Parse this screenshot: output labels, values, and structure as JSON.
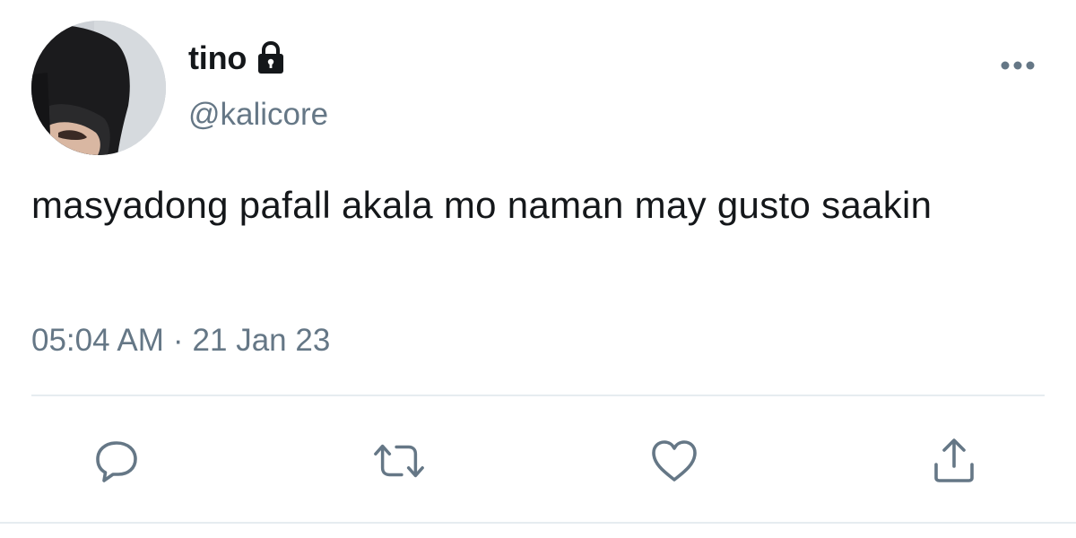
{
  "author": {
    "display_name": "tino",
    "handle": "@kalicore",
    "protected_icon": "lock-icon",
    "avatar": "profile-photo"
  },
  "tweet": {
    "text": "masyadong pafall akala mo naman may gusto saakin",
    "time": "05:04 AM",
    "separator": "·",
    "date": "21 Jan 23"
  },
  "menu": {
    "icon": "more-dots-icon"
  },
  "actions": [
    {
      "name": "reply",
      "icon": "reply-icon"
    },
    {
      "name": "retweet",
      "icon": "retweet-icon"
    },
    {
      "name": "like",
      "icon": "heart-icon"
    },
    {
      "name": "share",
      "icon": "share-icon"
    }
  ],
  "colors": {
    "primary_text": "#14171a",
    "secondary_text": "#657786",
    "divider": "#e6ecf0",
    "icon": "#657786"
  }
}
